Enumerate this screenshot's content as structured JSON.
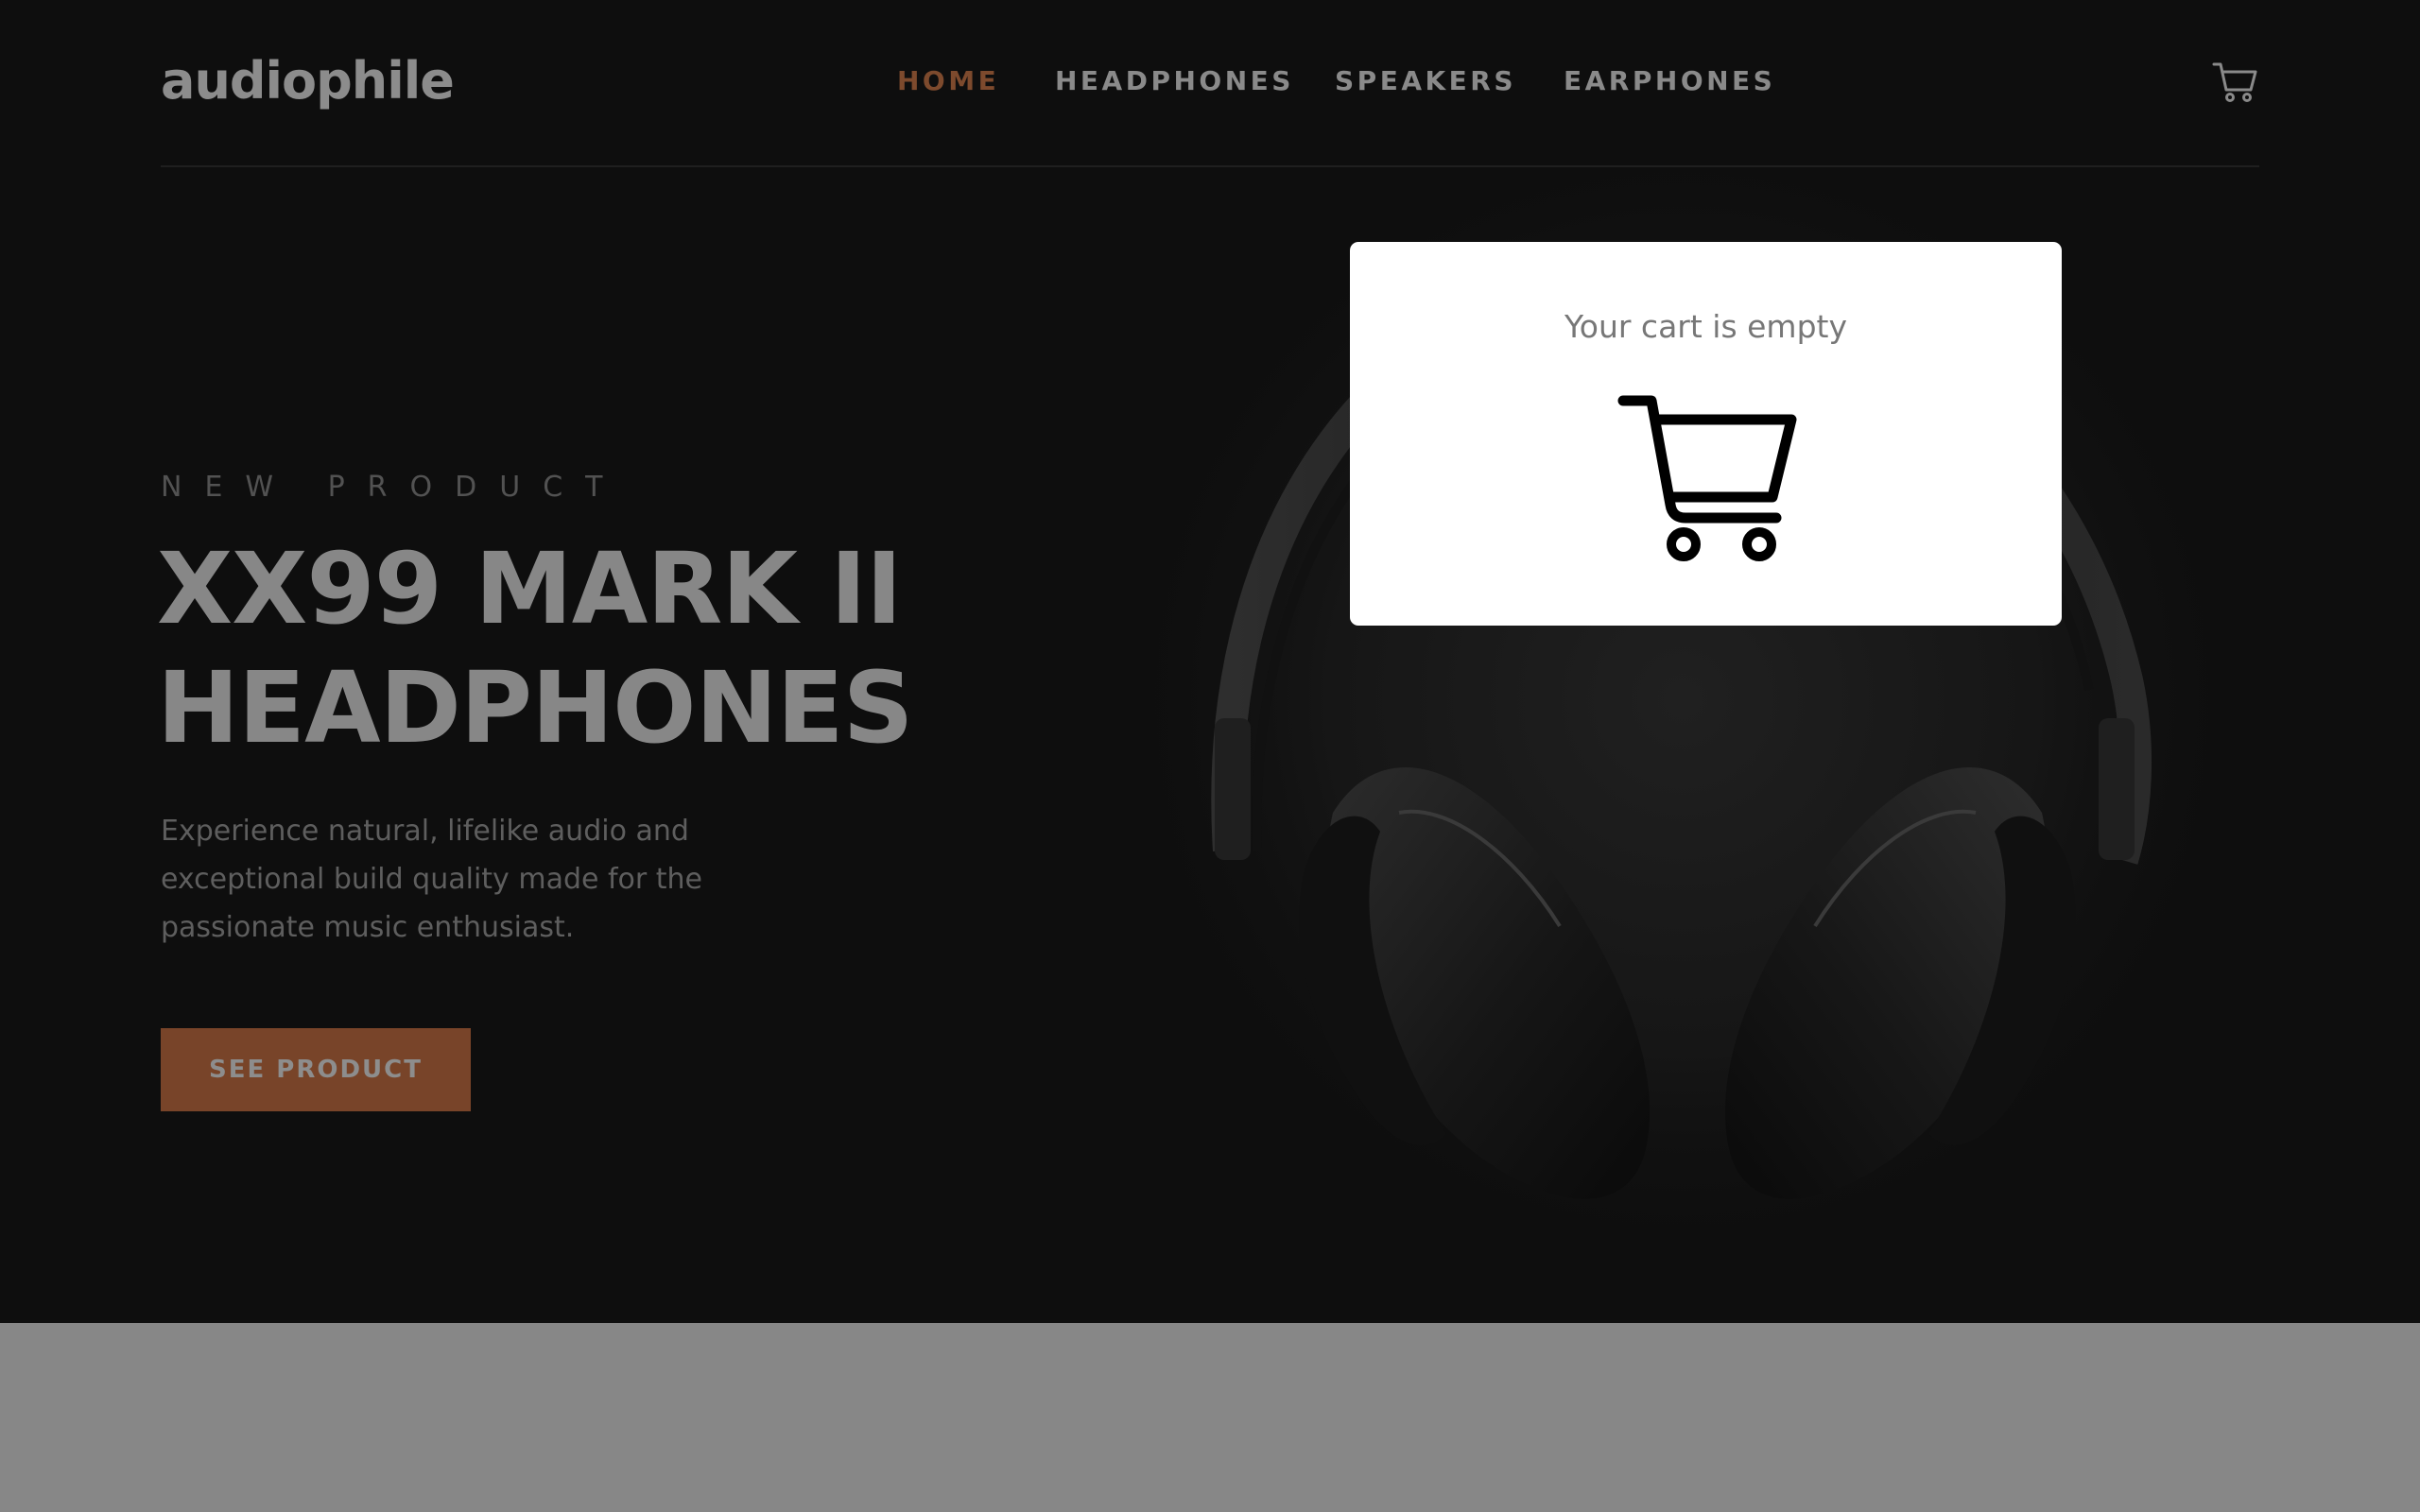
{
  "header": {
    "logo": "audiophile",
    "nav": [
      {
        "label": "HOME",
        "active": true
      },
      {
        "label": "HEADPHONES",
        "active": false
      },
      {
        "label": "SPEAKERS",
        "active": false
      },
      {
        "label": "EARPHONES",
        "active": false
      }
    ],
    "cart_icon": "cart-icon"
  },
  "hero": {
    "eyebrow": "NEW PRODUCT",
    "title_line1": "XX99 MARK II",
    "title_line2": "HEADPHONES",
    "description": "Experience natural, lifelike audio and exceptional build quality made for the passionate music enthusiast.",
    "cta_label": "SEE PRODUCT",
    "image": "headphones-image"
  },
  "cart_popup": {
    "message": "Your cart is empty",
    "icon": "shopping-cart-icon"
  },
  "colors": {
    "hero_background": "#0e0e0e",
    "accent": "#784429",
    "active_nav": "#7d4a2d",
    "overlay": "#878787",
    "popup_background": "#ffffff"
  }
}
